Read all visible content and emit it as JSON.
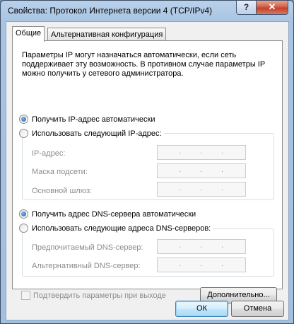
{
  "window": {
    "title": "Свойства: Протокол Интернета версии 4 (TCP/IPv4)",
    "help_glyph": "?",
    "close_glyph": "✕"
  },
  "tabs": [
    {
      "label": "Общие",
      "active": true
    },
    {
      "label": "Альтернативная конфигурация",
      "active": false
    }
  ],
  "description": "Параметры IP могут назначаться автоматически, если сеть поддерживает эту возможность. В противном случае параметры IP можно получить у сетевого администратора.",
  "ip": {
    "auto_label": "Получить IP-адрес автоматически",
    "auto_selected": true,
    "manual_label": "Использовать следующий IP-адрес:",
    "manual_selected": false,
    "fields": [
      {
        "label": "IP-адрес:",
        "value": "   .   .   ."
      },
      {
        "label": "Маска подсети:",
        "value": "   .   .   ."
      },
      {
        "label": "Основной шлюз:",
        "value": "   .   .   ."
      }
    ]
  },
  "dns": {
    "auto_label": "Получить адрес DNS-сервера автоматически",
    "auto_selected": true,
    "manual_label": "Использовать следующие адреса DNS-серверов:",
    "manual_selected": false,
    "fields": [
      {
        "label": "Предпочитаемый DNS-сервер:",
        "value": "   .   .   ."
      },
      {
        "label": "Альтернативный DNS-сервер:",
        "value": "   .   .   ."
      }
    ]
  },
  "validate_label": "Подтвердить параметры при выходе",
  "validate_checked": false,
  "buttons": {
    "advanced": "Дополнительно...",
    "ok": "ОК",
    "cancel": "Отмена"
  }
}
